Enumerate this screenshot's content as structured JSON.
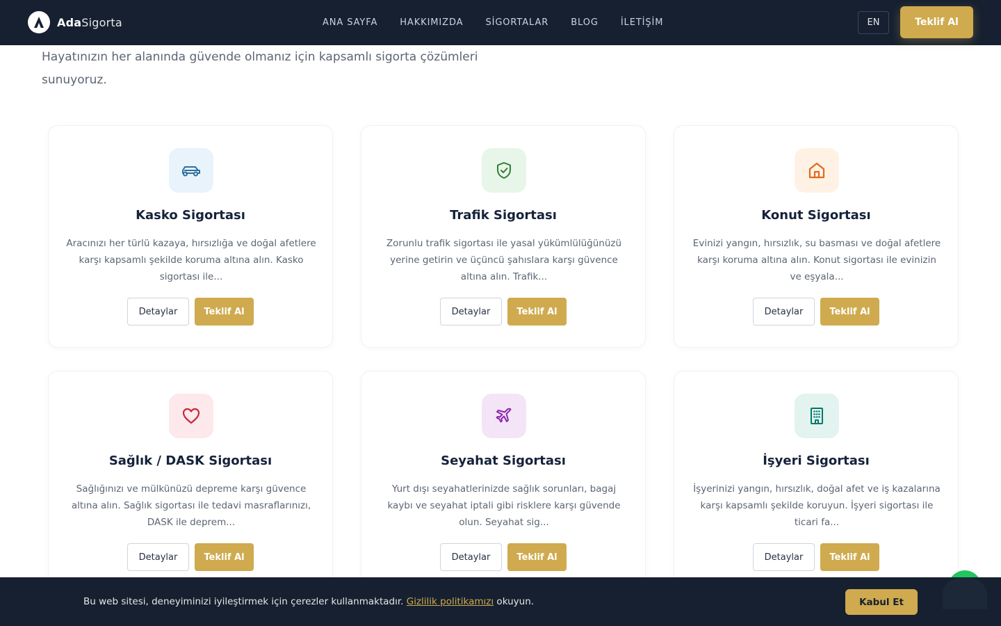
{
  "brand": {
    "name_bold": "Ada",
    "name_light": "Sigorta"
  },
  "nav": {
    "links": [
      "ANA SAYFA",
      "HAKKIMIZDA",
      "SİGORTALAR",
      "BLOG",
      "İLETİŞİM"
    ],
    "lang": "EN",
    "cta": "Teklif Al"
  },
  "intro": "Hayatınızın her alanında güvende olmanız için kapsamlı sigorta çözümleri sunuyoruz.",
  "cards": [
    {
      "icon": "car-icon",
      "color": "#2f6fa0",
      "bg": "#e8f3fb",
      "title": "Kasko Sigortası",
      "desc": "Aracınızı her türlü kazaya, hırsızlığa ve doğal afetlere karşı kapsamlı şekilde koruma altına alın. Kasko sigortası ile...",
      "details": "Detaylar",
      "quote": "Teklif Al"
    },
    {
      "icon": "shield-check-icon",
      "color": "#2e7d32",
      "bg": "#e8f5e9",
      "title": "Trafik Sigortası",
      "desc": "Zorunlu trafik sigortası ile yasal yükümlülüğünüzü yerine getirin ve üçüncü şahıslara karşı güvence altına alın. Trafik...",
      "details": "Detaylar",
      "quote": "Teklif Al"
    },
    {
      "icon": "home-icon",
      "color": "#e06a1b",
      "bg": "#fff2e5",
      "title": "Konut Sigortası",
      "desc": "Evinizi yangın, hırsızlık, su basması ve doğal afetlere karşı koruma altına alın. Konut sigortası ile evinizin ve eşyala...",
      "details": "Detaylar",
      "quote": "Teklif Al"
    },
    {
      "icon": "heart-icon",
      "color": "#c62839",
      "bg": "#fde8ec",
      "title": "Sağlık / DASK Sigortası",
      "desc": "Sağlığınızı ve mülkünüzü depreme karşı güvence altına alın. Sağlık sigortası ile tedavi masraflarınızı, DASK ile deprem...",
      "details": "Detaylar",
      "quote": "Teklif Al"
    },
    {
      "icon": "plane-icon",
      "color": "#8e24aa",
      "bg": "#f3e5f7",
      "title": "Seyahat Sigortası",
      "desc": "Yurt dışı seyahatlerinizde sağlık sorunları, bagaj kaybı ve seyahat iptali gibi risklere karşı güvende olun. Seyahat sig...",
      "details": "Detaylar",
      "quote": "Teklif Al"
    },
    {
      "icon": "building-icon",
      "color": "#00796b",
      "bg": "#e2f3f0",
      "title": "İşyeri Sigortası",
      "desc": "İşyerinizi yangın, hırsızlık, doğal afet ve iş kazalarına karşı kapsamlı şekilde koruyun. İşyeri sigortası ile ticari fa...",
      "details": "Detaylar",
      "quote": "Teklif Al"
    }
  ],
  "cookie": {
    "text_before": "Bu web sitesi, deneyiminizi iyileştirmek için çerezler kullanmaktadır. ",
    "link": "Gizlilik politikamızı",
    "text_after": " okuyun.",
    "accept": "Kabul Et"
  }
}
